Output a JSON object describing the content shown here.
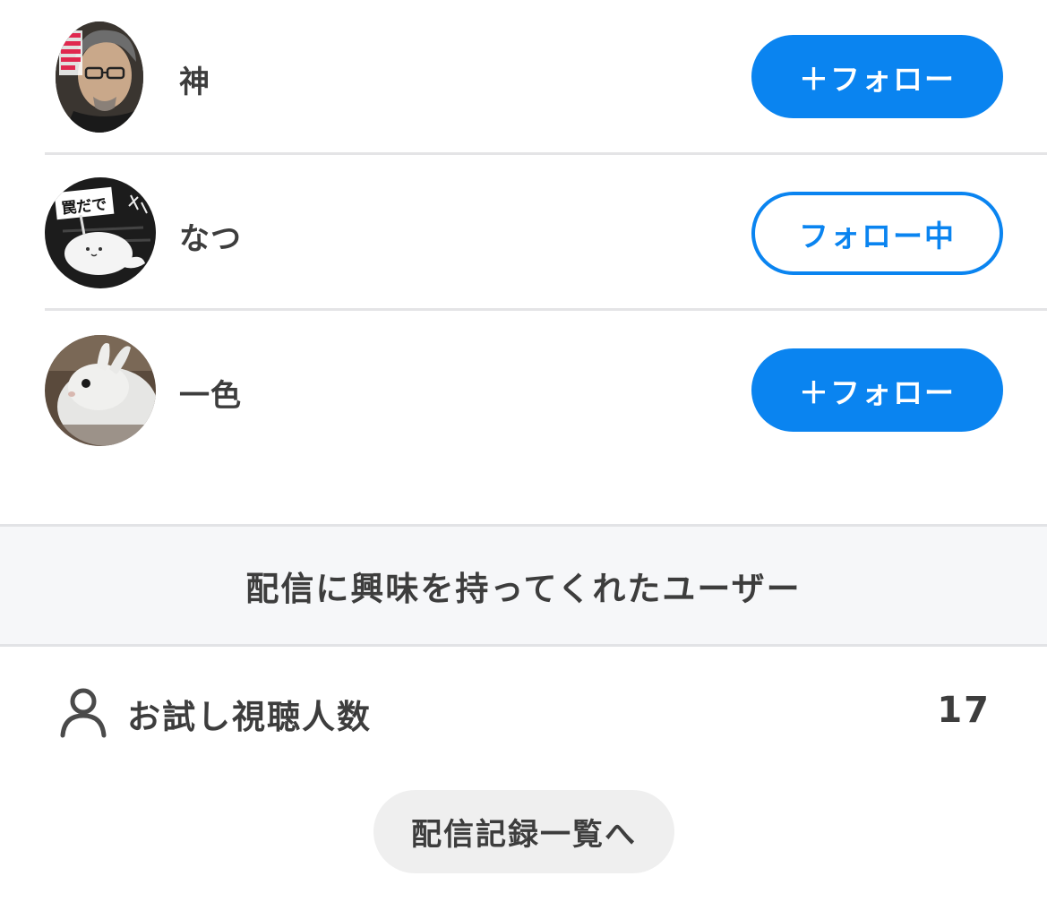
{
  "users": [
    {
      "name": "神",
      "follow_label": "＋フォロー",
      "following": false
    },
    {
      "name": "なつ",
      "follow_label": "フォロー中",
      "following": true
    },
    {
      "name": "一色",
      "follow_label": "＋フォロー",
      "following": false
    }
  ],
  "avatar_text": {
    "user2_sign": "罠だで"
  },
  "section": {
    "title": "配信に興味を持ってくれたユーザー"
  },
  "stats": {
    "trial_viewers_label": "お試し視聴人数",
    "trial_viewers_value": "17"
  },
  "history_button_label": "配信記録一覧へ",
  "colors": {
    "accent": "#0a84f0",
    "text": "#3d3d3d",
    "divider": "#e4e4e6",
    "section_bg": "#f6f7f9",
    "secondary_button_bg": "#efefef"
  }
}
